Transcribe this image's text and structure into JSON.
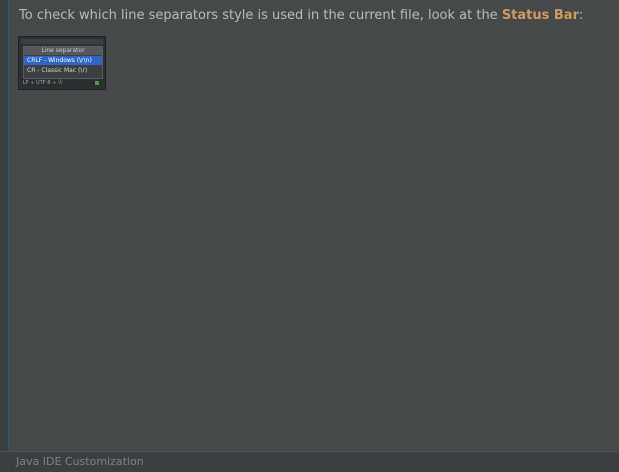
{
  "tip": {
    "text_before": "To check which line separators style is used in the current file, look at the ",
    "highlight": "Status Bar",
    "text_after": ":"
  },
  "thumbnail": {
    "popup_title": "Line separator",
    "items": [
      {
        "label": "CRLF - Windows (\\r\\n)",
        "selected": true
      },
      {
        "label": "CR - Classic Mac (\\r)",
        "selected": false
      }
    ],
    "status_bar_text": "LF ÷ UTF-8 ÷ Ⓐ"
  },
  "footer": {
    "label": "Java IDE Customization"
  }
}
